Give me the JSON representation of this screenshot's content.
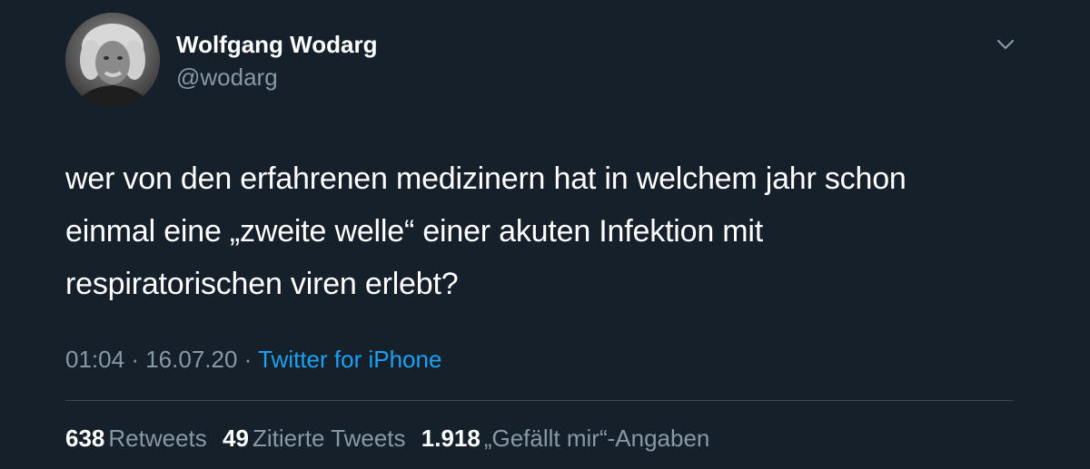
{
  "author": {
    "display_name": "Wolfgang Wodarg",
    "handle": "@wodarg"
  },
  "tweet": {
    "lines": [
      "wer von den erfahrenen medizinern hat in welchem jahr schon",
      "einmal eine „zweite welle“ einer akuten Infektion mit",
      "respiratorischen viren erlebt?"
    ],
    "time": "01:04",
    "date": "16.07.20",
    "separator": "·",
    "source": "Twitter for iPhone"
  },
  "stats": {
    "retweets": {
      "count": "638",
      "label": "Retweets"
    },
    "quotes": {
      "count": "49",
      "label": "Zitierte Tweets"
    },
    "likes": {
      "count": "1.918",
      "label": "„Gefällt mir“-Angaben"
    }
  },
  "icons": {
    "caret": "chevron-down-icon",
    "avatar": "avatar"
  },
  "colors": {
    "background": "#15202b",
    "primary_text": "#ffffff",
    "secondary_text": "#8899a6",
    "link": "#1da1f2",
    "divider": "#38444d"
  }
}
